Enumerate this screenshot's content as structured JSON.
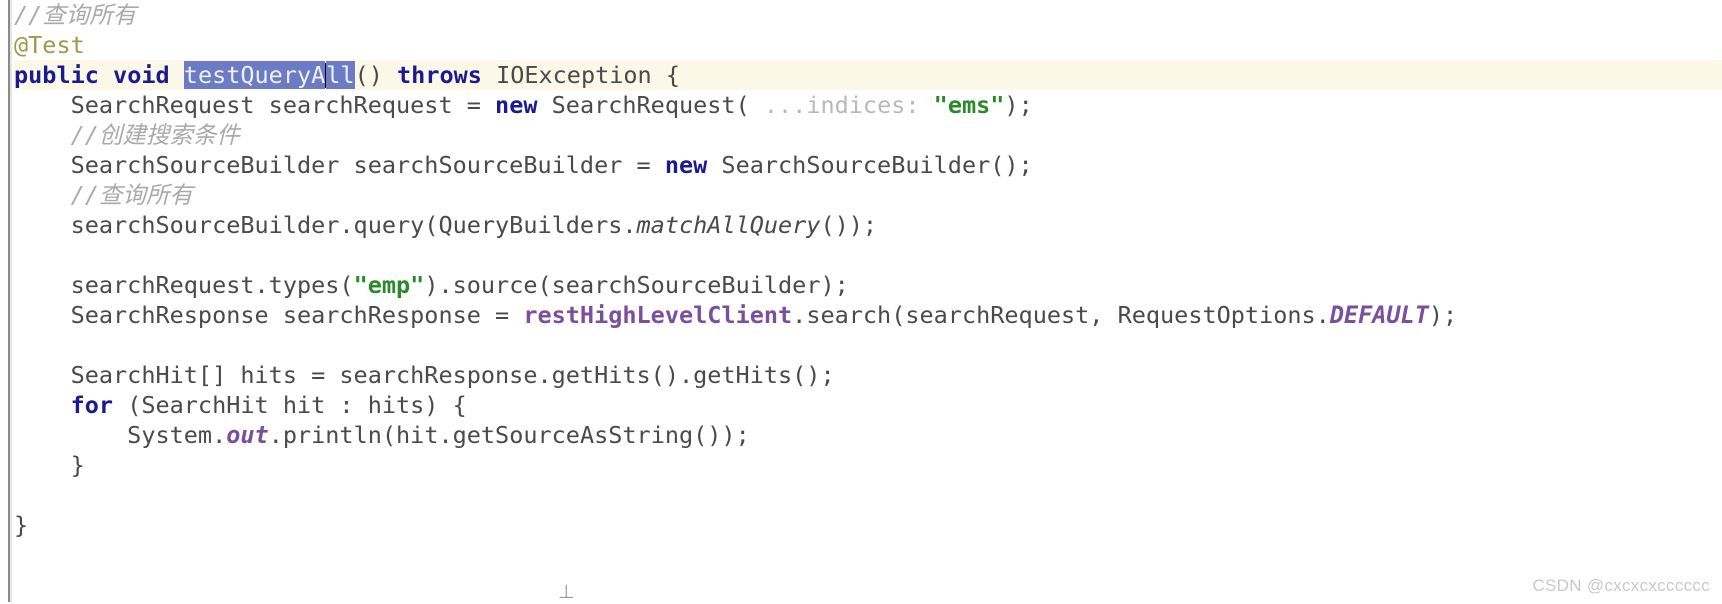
{
  "editor": {
    "language": "java",
    "theme": "light",
    "colors": {
      "background": "#ffffff",
      "current_line_highlight": "#fbf8e8",
      "selection": "#6b7cc4",
      "keyword": "#1b1b8f",
      "comment": "#aaaaaa",
      "string": "#2a8a2a",
      "annotation": "#9a9a4a",
      "field": "#7a4f9e",
      "parameter_hint": "#b9b9b9",
      "default_text": "#4a4a4a",
      "gutter_border": "#8a8a8a"
    },
    "caret": {
      "line": 3,
      "after_text": "testQueryA"
    },
    "selection_text": "testQueryAll"
  },
  "code": {
    "lines": [
      {
        "n": 1,
        "current": false,
        "tokens": [
          {
            "t": "//查询所有",
            "k": "cmt"
          }
        ]
      },
      {
        "n": 2,
        "current": false,
        "tokens": [
          {
            "t": "@Test",
            "k": "anno"
          }
        ]
      },
      {
        "n": 3,
        "current": true,
        "tokens": [
          {
            "t": "public",
            "k": "kw"
          },
          {
            "t": " ",
            "k": "plain"
          },
          {
            "t": "void",
            "k": "kw"
          },
          {
            "t": " ",
            "k": "plain"
          },
          {
            "t": "testQueryA",
            "k": "sel"
          },
          {
            "t": "",
            "k": "caret"
          },
          {
            "t": "ll",
            "k": "sel"
          },
          {
            "t": "() ",
            "k": "plain"
          },
          {
            "t": "throws",
            "k": "kw"
          },
          {
            "t": " IOException {",
            "k": "plain"
          }
        ]
      },
      {
        "n": 4,
        "current": false,
        "tokens": [
          {
            "t": "    SearchRequest searchRequest = ",
            "k": "plain"
          },
          {
            "t": "new",
            "k": "kw"
          },
          {
            "t": " SearchRequest(",
            "k": "plain"
          },
          {
            "t": " ...indices:",
            "k": "hint"
          },
          {
            "t": " ",
            "k": "plain"
          },
          {
            "t": "\"ems\"",
            "k": "str"
          },
          {
            "t": ");",
            "k": "plain"
          }
        ]
      },
      {
        "n": 5,
        "current": false,
        "tokens": [
          {
            "t": "    //创建搜索条件",
            "k": "cmt"
          }
        ]
      },
      {
        "n": 6,
        "current": false,
        "tokens": [
          {
            "t": "    SearchSourceBuilder searchSourceBuilder = ",
            "k": "plain"
          },
          {
            "t": "new",
            "k": "kw"
          },
          {
            "t": " SearchSourceBuilder();",
            "k": "plain"
          }
        ]
      },
      {
        "n": 7,
        "current": false,
        "tokens": [
          {
            "t": "    //查询所有",
            "k": "cmt"
          }
        ]
      },
      {
        "n": 8,
        "current": false,
        "tokens": [
          {
            "t": "    searchSourceBuilder.query(QueryBuilders.",
            "k": "plain"
          },
          {
            "t": "matchAllQuery",
            "k": "staticm"
          },
          {
            "t": "());",
            "k": "plain"
          }
        ]
      },
      {
        "n": 9,
        "current": false,
        "tokens": []
      },
      {
        "n": 10,
        "current": false,
        "tokens": [
          {
            "t": "    searchRequest.types(",
            "k": "plain"
          },
          {
            "t": "\"emp\"",
            "k": "str"
          },
          {
            "t": ").source(searchSourceBuilder);",
            "k": "plain"
          }
        ]
      },
      {
        "n": 11,
        "current": false,
        "tokens": [
          {
            "t": "    SearchResponse searchResponse = ",
            "k": "plain"
          },
          {
            "t": "restHighLevelClient",
            "k": "field"
          },
          {
            "t": ".search(searchRequest, RequestOptions.",
            "k": "plain"
          },
          {
            "t": "DEFAULT",
            "k": "constant"
          },
          {
            "t": ");",
            "k": "plain"
          }
        ]
      },
      {
        "n": 12,
        "current": false,
        "tokens": []
      },
      {
        "n": 13,
        "current": false,
        "tokens": [
          {
            "t": "    SearchHit[] hits = searchResponse.getHits().getHits();",
            "k": "plain"
          }
        ]
      },
      {
        "n": 14,
        "current": false,
        "tokens": [
          {
            "t": "    ",
            "k": "plain"
          },
          {
            "t": "for",
            "k": "kw"
          },
          {
            "t": " (SearchHit hit : hits) {",
            "k": "plain"
          }
        ]
      },
      {
        "n": 15,
        "current": false,
        "tokens": [
          {
            "t": "        System.",
            "k": "plain"
          },
          {
            "t": "out",
            "k": "constant"
          },
          {
            "t": ".println(hit.getSourceAsString());",
            "k": "plain"
          }
        ]
      },
      {
        "n": 16,
        "current": false,
        "tokens": [
          {
            "t": "    }",
            "k": "plain"
          }
        ]
      },
      {
        "n": 17,
        "current": false,
        "tokens": []
      },
      {
        "n": 18,
        "current": false,
        "tokens": [
          {
            "t": "}",
            "k": "plain"
          }
        ]
      }
    ]
  },
  "watermark": {
    "text": "CSDN @cxcxcxcccccc"
  },
  "stray": {
    "glyph": "⊥"
  }
}
